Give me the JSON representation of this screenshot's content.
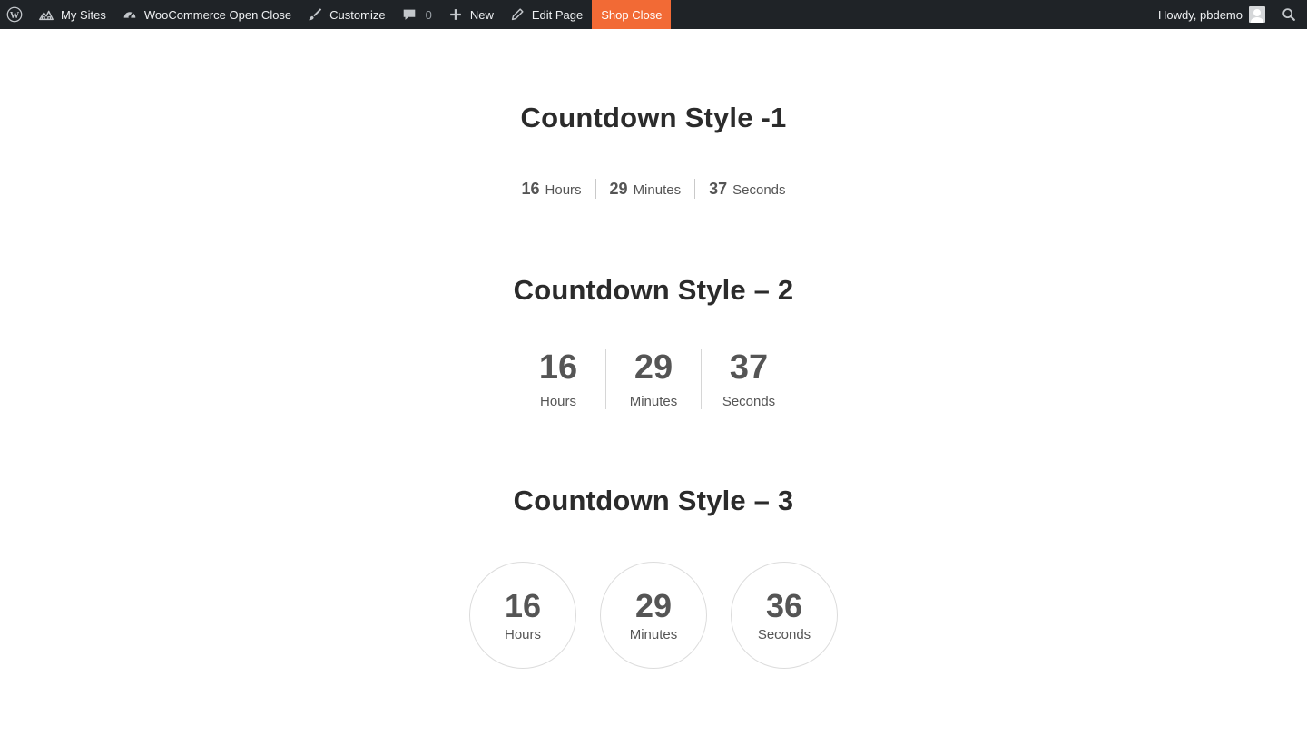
{
  "admin_bar": {
    "my_sites": "My Sites",
    "site_name": "WooCommerce Open Close",
    "customize": "Customize",
    "comments_count": "0",
    "new": "New",
    "edit_page": "Edit Page",
    "shop_status": "Shop Close",
    "greeting": "Howdy, pbdemo",
    "colors": {
      "bar": "#1f2327",
      "shop_status_bg": "#f26a35"
    }
  },
  "sections": [
    {
      "title": "Countdown Style -1",
      "units": [
        {
          "value": "16",
          "label": "Hours"
        },
        {
          "value": "29",
          "label": "Minutes"
        },
        {
          "value": "37",
          "label": "Seconds"
        }
      ]
    },
    {
      "title": "Countdown Style – 2",
      "units": [
        {
          "value": "16",
          "label": "Hours"
        },
        {
          "value": "29",
          "label": "Minutes"
        },
        {
          "value": "37",
          "label": "Seconds"
        }
      ]
    },
    {
      "title": "Countdown Style – 3",
      "units": [
        {
          "value": "16",
          "label": "Hours"
        },
        {
          "value": "29",
          "label": "Minutes"
        },
        {
          "value": "36",
          "label": "Seconds"
        }
      ]
    }
  ]
}
